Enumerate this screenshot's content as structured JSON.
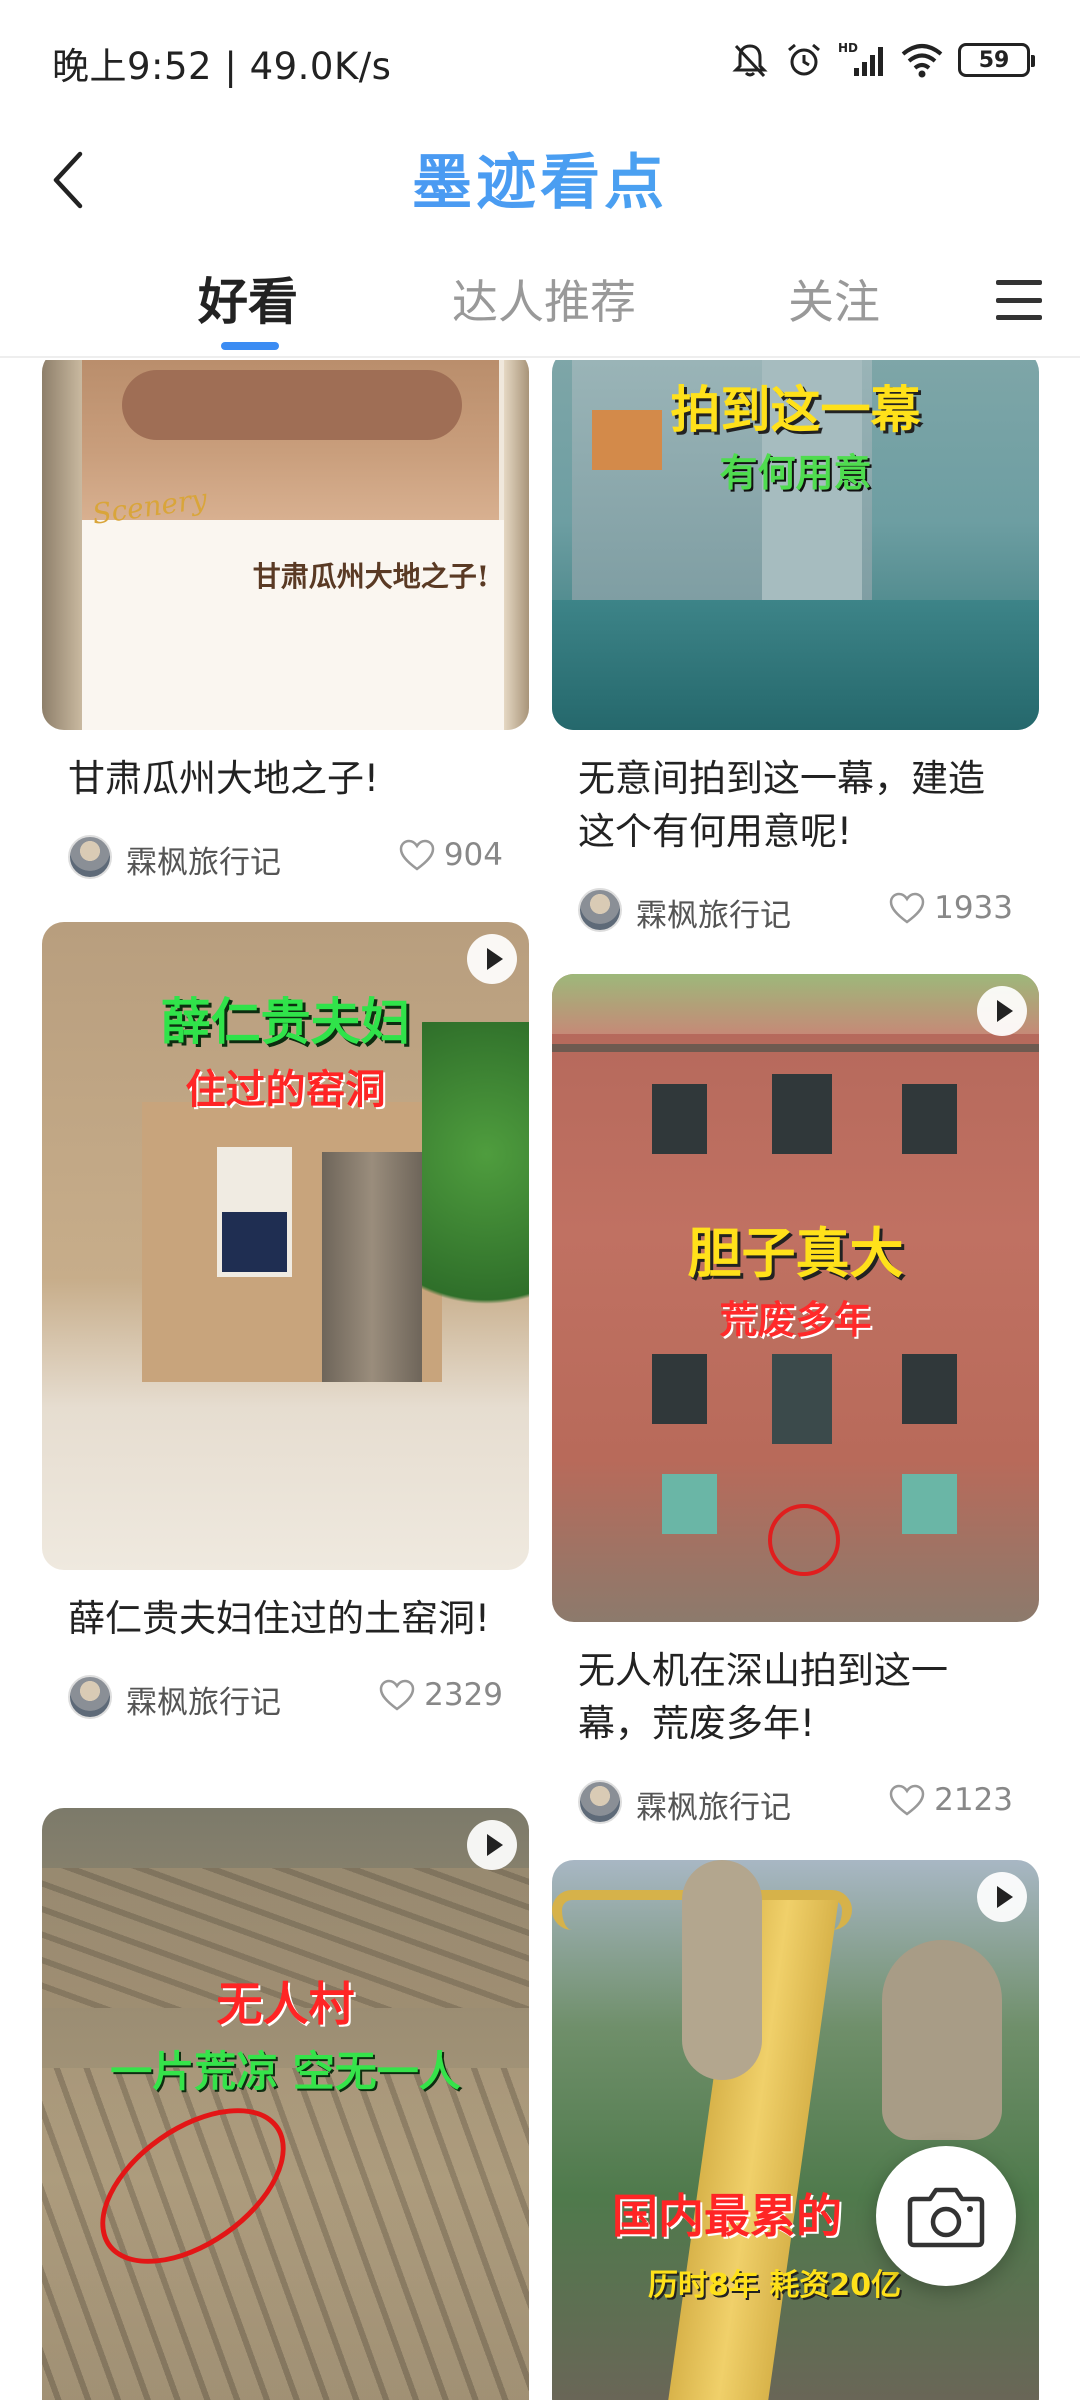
{
  "status_bar": {
    "time_speed": "晚上9:52 | 49.0K/s",
    "battery": "59",
    "icons": [
      "mute-bell-icon",
      "alarm-icon",
      "hd-signal-icon",
      "wifi-icon",
      "battery-icon"
    ]
  },
  "header": {
    "app_title": "墨迹看点",
    "back_icon": "back-chevron-icon"
  },
  "tabs": {
    "items": [
      {
        "label": "好看",
        "active": true
      },
      {
        "label": "达人推荐",
        "active": false
      },
      {
        "label": "关注",
        "active": false
      }
    ],
    "menu_icon": "hamburger-menu-icon"
  },
  "feed": {
    "cards": [
      {
        "title": "甘肃瓜州大地之子!",
        "author": "霖枫旅行记",
        "likes": "904",
        "overlay_main": "甘肃瓜州大地之子!",
        "overlay_script": "Scenery",
        "has_play": false
      },
      {
        "title": "无意间拍到这一幕，建造这个有何用意呢!",
        "author": "霖枫旅行记",
        "likes": "1933",
        "overlay_main": "拍到这一幕",
        "overlay_sub": "有何用意",
        "has_play": false
      },
      {
        "title": "薛仁贵夫妇住过的土窑洞!",
        "author": "霖枫旅行记",
        "likes": "2329",
        "overlay_main": "薛仁贵夫妇",
        "overlay_sub": "住过的窑洞",
        "has_play": true
      },
      {
        "title": "无人机在深山拍到这一幕，荒废多年!",
        "author": "霖枫旅行记",
        "likes": "2123",
        "overlay_main": "胆子真大",
        "overlay_sub": "荒废多年",
        "has_play": true
      },
      {
        "title": "",
        "overlay_main": "无人村",
        "overlay_sub": "一片荒凉 空无一人",
        "has_play": true
      },
      {
        "title": "",
        "overlay_main": "国内最累的",
        "overlay_sub": "历时8年 耗资20亿",
        "has_play": true
      }
    ]
  },
  "fab": {
    "icon": "camera-icon"
  }
}
